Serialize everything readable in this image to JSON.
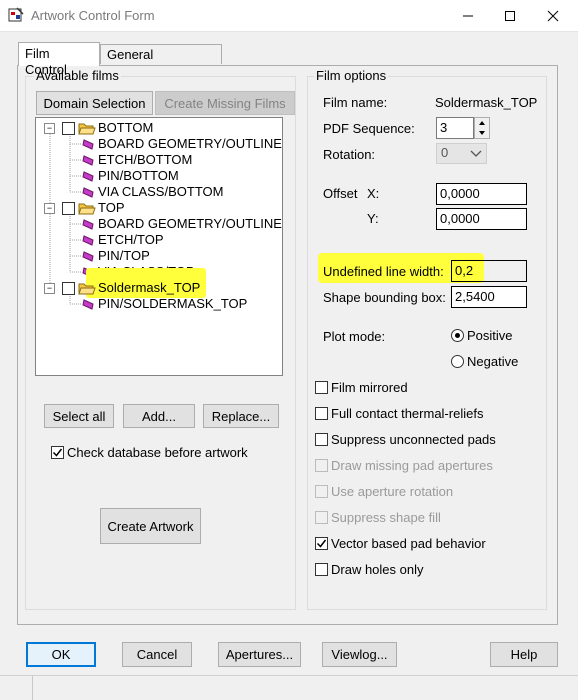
{
  "window": {
    "title": "Artwork Control Form"
  },
  "tabs": [
    {
      "label": "Film Control",
      "active": true
    },
    {
      "label": "General Parameters",
      "active": false
    }
  ],
  "available_films": {
    "legend": "Available films",
    "domain_selection": "Domain Selection",
    "create_missing": "Create Missing Films",
    "tree": [
      {
        "label": "BOTTOM",
        "level": 0
      },
      {
        "label": "BOARD GEOMETRY/OUTLINE",
        "level": 1
      },
      {
        "label": "ETCH/BOTTOM",
        "level": 1
      },
      {
        "label": "PIN/BOTTOM",
        "level": 1
      },
      {
        "label": "VIA CLASS/BOTTOM",
        "level": 1
      },
      {
        "label": "TOP",
        "level": 0
      },
      {
        "label": "BOARD GEOMETRY/OUTLINE",
        "level": 1
      },
      {
        "label": "ETCH/TOP",
        "level": 1
      },
      {
        "label": "PIN/TOP",
        "level": 1
      },
      {
        "label": "VIA CLASS/TOP",
        "level": 1
      },
      {
        "label": "Soldermask_TOP",
        "level": 0
      },
      {
        "label": "PIN/SOLDERMASK_TOP",
        "level": 1
      }
    ],
    "select_all": "Select all",
    "add": "Add...",
    "replace": "Replace...",
    "check_db_label": "Check database before artwork",
    "create_artwork": "Create Artwork"
  },
  "film_options": {
    "legend": "Film options",
    "film_name_label": "Film name:",
    "film_name_value": "Soldermask_TOP",
    "pdf_seq_label": "PDF Sequence:",
    "pdf_seq_value": "3",
    "rotation_label": "Rotation:",
    "rotation_value": "0",
    "offset_label": "Offset",
    "x_label": "X:",
    "x_value": "0,0000",
    "y_label": "Y:",
    "y_value": "0,0000",
    "undefined_lw_label": "Undefined line width:",
    "undefined_lw_value": "0,2",
    "shape_bb_label": "Shape bounding box:",
    "shape_bb_value": "2,5400",
    "plot_mode_label": "Plot mode:",
    "positive": "Positive",
    "negative": "Negative",
    "options": [
      {
        "label": "Film mirrored",
        "checked": false,
        "enabled": true
      },
      {
        "label": "Full contact thermal-reliefs",
        "checked": false,
        "enabled": true
      },
      {
        "label": "Suppress unconnected pads",
        "checked": false,
        "enabled": true
      },
      {
        "label": "Draw missing pad apertures",
        "checked": false,
        "enabled": false
      },
      {
        "label": "Use aperture rotation",
        "checked": false,
        "enabled": false
      },
      {
        "label": "Suppress shape fill",
        "checked": false,
        "enabled": false
      },
      {
        "label": "Vector based pad behavior",
        "checked": true,
        "enabled": true
      },
      {
        "label": "Draw holes only",
        "checked": false,
        "enabled": true
      }
    ]
  },
  "bottom_buttons": {
    "ok": "OK",
    "cancel": "Cancel",
    "apertures": "Apertures...",
    "viewlog": "Viewlog...",
    "help": "Help"
  },
  "colors": {
    "highlight": "#ffff3c",
    "folder": "#f5c542",
    "leaf_icon": "#c43cc4"
  }
}
